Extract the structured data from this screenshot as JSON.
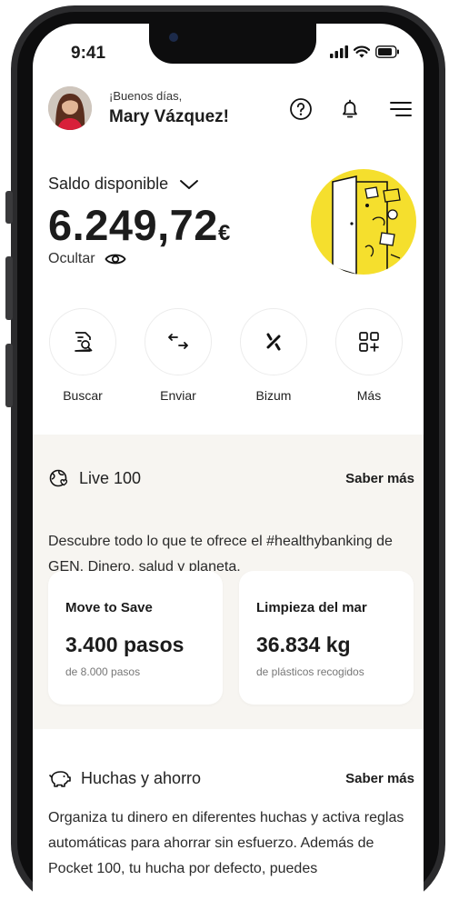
{
  "status_bar": {
    "time": "9:41"
  },
  "header": {
    "greeting": "¡Buenos días,",
    "user_name": "Mary Vázquez!"
  },
  "balance": {
    "label": "Saldo disponible",
    "amount": "6.249,72",
    "currency": "€",
    "hide_label": "Ocultar"
  },
  "actions": [
    {
      "label": "Buscar",
      "icon": "search-document-icon"
    },
    {
      "label": "Enviar",
      "icon": "transfer-arrows-icon"
    },
    {
      "label": "Bizum",
      "icon": "bizum-icon"
    },
    {
      "label": "Más",
      "icon": "grid-plus-icon"
    }
  ],
  "live_section": {
    "title": "Live 100",
    "link": "Saber más",
    "description": "Descubre todo lo que te ofrece el #healthybanking de GEN. Dinero, salud y planeta.",
    "cards": [
      {
        "title": "Move to Save",
        "value": "3.400 pasos",
        "subtitle": "de 8.000 pasos"
      },
      {
        "title": "Limpieza del mar",
        "value": "36.834 kg",
        "subtitle": "de plásticos recogidos"
      }
    ]
  },
  "huchas_section": {
    "title": "Huchas y ahorro",
    "link": "Saber más",
    "description": "Organiza tu dinero en diferentes huchas y activa reglas automáticas para ahorrar sin esfuerzo. Además de Pocket 100, tu hucha por defecto, puedes"
  },
  "colors": {
    "accent_yellow": "#f5df2d",
    "section_bg": "#f7f5f1",
    "text": "#1c1c1c"
  }
}
